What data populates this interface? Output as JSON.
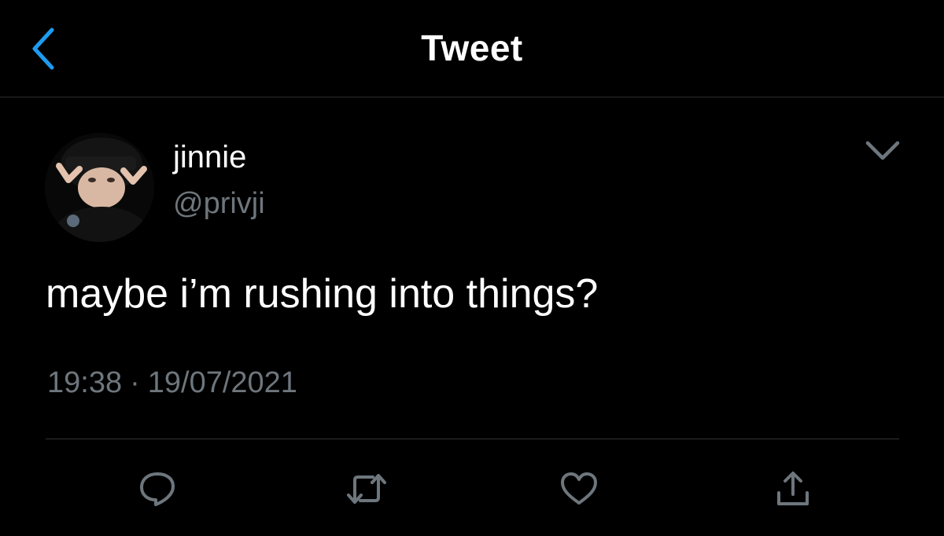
{
  "header": {
    "title": "Tweet",
    "back_icon": "chevron-left-icon",
    "accent_color": "#1d9bf0"
  },
  "tweet": {
    "display_name": "jinnie",
    "handle": "@privji",
    "text": "maybe i’m rushing into things?",
    "time": "19:38",
    "separator": "·",
    "date": "19/07/2021",
    "more_icon": "chevron-down-icon"
  },
  "actions": [
    {
      "name": "reply",
      "icon": "reply-icon"
    },
    {
      "name": "retweet",
      "icon": "retweet-icon"
    },
    {
      "name": "like",
      "icon": "heart-icon"
    },
    {
      "name": "share",
      "icon": "share-icon"
    }
  ],
  "colors": {
    "background": "#000000",
    "text": "#ffffff",
    "secondary_text": "#6e767d",
    "divider": "#2f3336"
  }
}
